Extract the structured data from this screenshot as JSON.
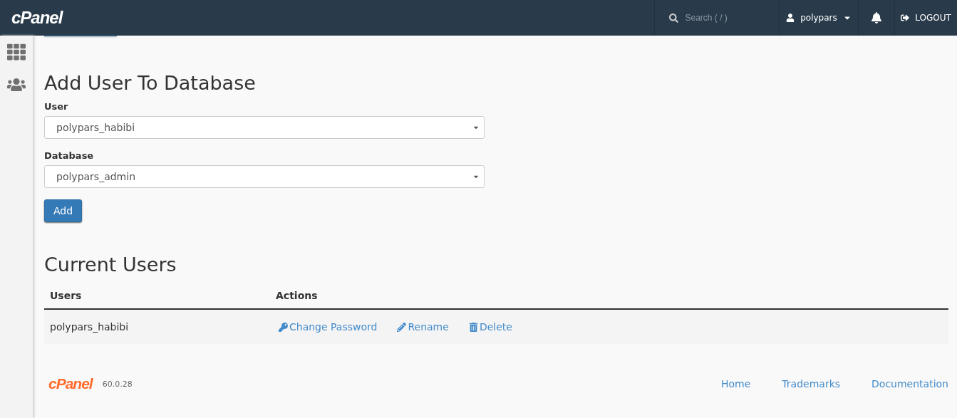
{
  "header": {
    "logo": "cPanel",
    "search": {
      "placeholder": "Search ( / )"
    },
    "user": "polypars",
    "logout": "LOGOUT"
  },
  "add_user": {
    "title": "Add User To Database",
    "fields": [
      {
        "label": "User",
        "value": "polypars_habibi"
      },
      {
        "label": "Database",
        "value": "polypars_admin"
      }
    ],
    "button": "Add"
  },
  "current_users": {
    "title": "Current Users",
    "columns": [
      "Users",
      "Actions"
    ],
    "rows": [
      {
        "user": "polypars_habibi",
        "actions": [
          {
            "kind": "password",
            "label": "Change Password"
          },
          {
            "kind": "rename",
            "label": "Rename"
          },
          {
            "kind": "delete",
            "label": "Delete"
          }
        ]
      }
    ]
  },
  "footer": {
    "logo": "cPanel",
    "version": "60.0.28",
    "links": [
      "Home",
      "Trademarks",
      "Documentation"
    ]
  }
}
